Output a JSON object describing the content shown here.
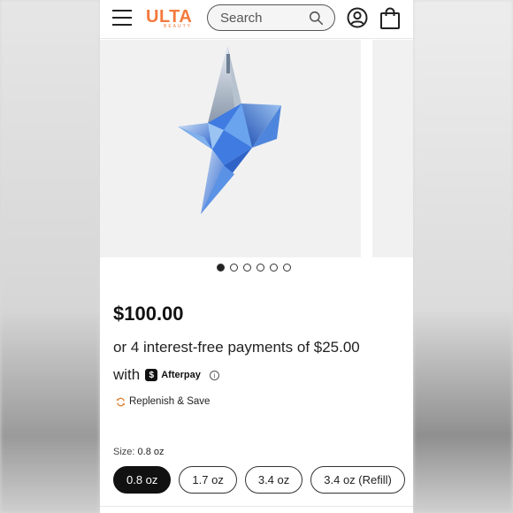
{
  "header": {
    "logo_text": "ULTA",
    "logo_subtext": "BEAUTY",
    "search_placeholder": "Search",
    "icons": [
      "menu-icon",
      "search-icon",
      "account-icon",
      "bag-icon"
    ]
  },
  "carousel": {
    "slide_count": 6,
    "active_index": 0
  },
  "product": {
    "price": "$100.00",
    "installments_text": "or 4 interest-free payments of $25.00",
    "with_text": "with",
    "afterpay_mark": "$",
    "afterpay_label": "Afterpay",
    "info_glyph": "i",
    "replenish_text": "Replenish & Save"
  },
  "size": {
    "label": "Size:",
    "selected_value": "0.8 oz",
    "options": [
      {
        "label": "0.8 oz",
        "selected": true
      },
      {
        "label": "1.7 oz",
        "selected": false
      },
      {
        "label": "3.4 oz",
        "selected": false
      },
      {
        "label": "3.4 oz (Refill)",
        "selected": false
      }
    ]
  },
  "colors": {
    "brand_orange": "#f47a3d",
    "selected_bg": "#111111",
    "star_blue": "#3a78d8"
  }
}
